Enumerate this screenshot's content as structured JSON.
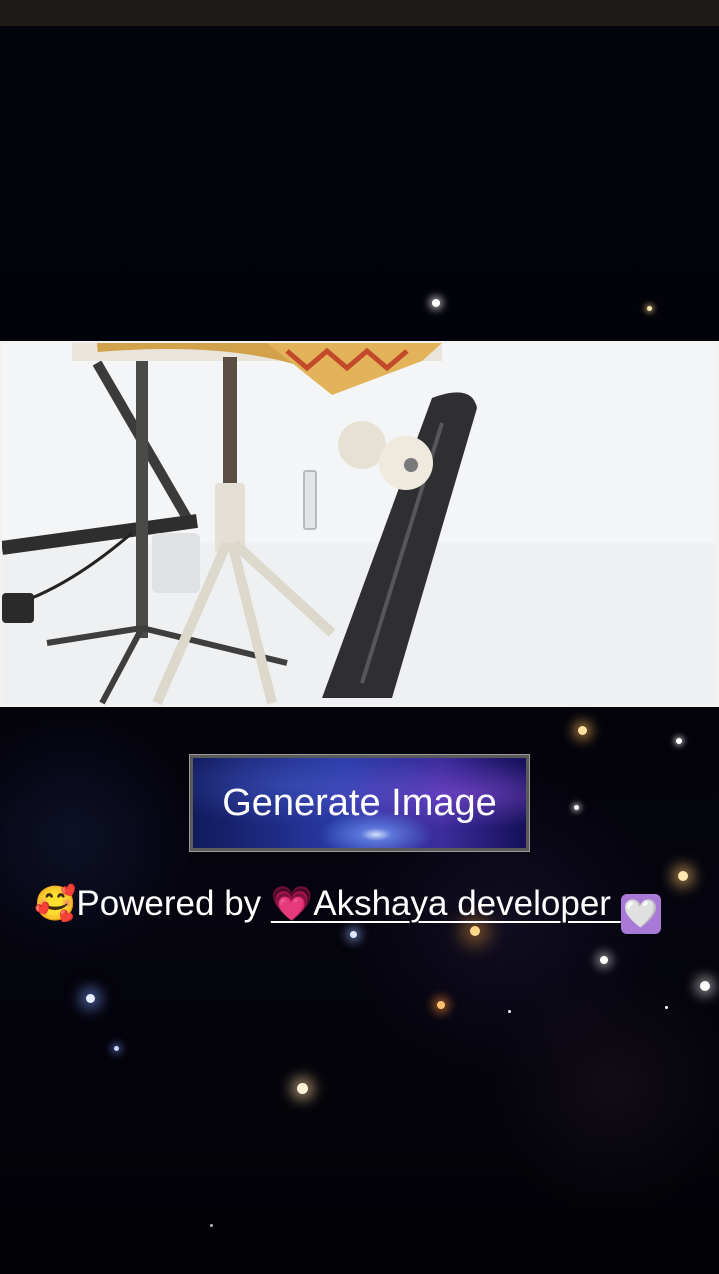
{
  "page": {
    "button_label": "Generate Image",
    "powered_prefix": "Powered by",
    "developer_name": "Akshaya developer",
    "emoji_hugging": "🥰",
    "emoji_pink_heart": "💗",
    "emoji_white_heart": "🤍"
  },
  "photo": {
    "icon": "image-preview",
    "subject": "stool-skateboard-photo"
  },
  "colors": {
    "status_bar": "#1d1a17",
    "background": "#03030c",
    "text": "#ffffff",
    "button_border": "#5a5a5a"
  }
}
